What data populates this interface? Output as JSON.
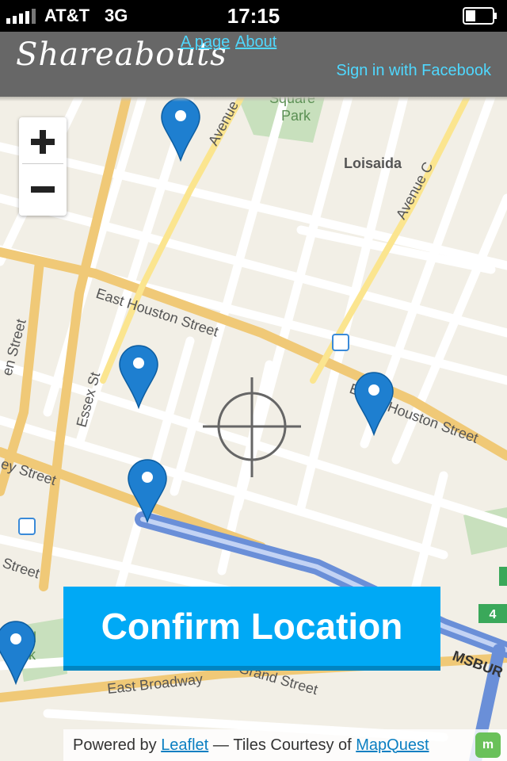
{
  "status_bar": {
    "carrier": "AT&T",
    "network": "3G",
    "time": "17:15"
  },
  "header": {
    "logo": "Shareabouts",
    "nav": [
      {
        "label": "A page"
      },
      {
        "label": "About"
      }
    ],
    "signin_label": "Sign in with Facebook"
  },
  "map": {
    "labels": {
      "park": "Square\nPark",
      "neighborhood": "Loisaida",
      "avenue_a": "Avenue",
      "avenue_c": "Avenue C",
      "east_houston_1": "East Houston Street",
      "east_houston_2": "E",
      "houston_street_2": "Houston Street",
      "essex": "Essex St",
      "left_street_1": "en Street",
      "left_street_2": "ey Street",
      "left_street_3": "Street",
      "east_broadway": "East Broadway",
      "grand_street": "Grand Street",
      "park_bottom": "rd\nrk",
      "williamsburg": "MSBUR",
      "route_4": "4"
    },
    "markers": 5
  },
  "zoom": {
    "in_label": "+",
    "out_label": "−"
  },
  "confirm_label": "Confirm Location",
  "attribution": {
    "powered_by": "Powered by",
    "leaflet": "Leaflet",
    "separator": "—",
    "tiles": "Tiles Courtesy of",
    "mapquest": "MapQuest"
  }
}
